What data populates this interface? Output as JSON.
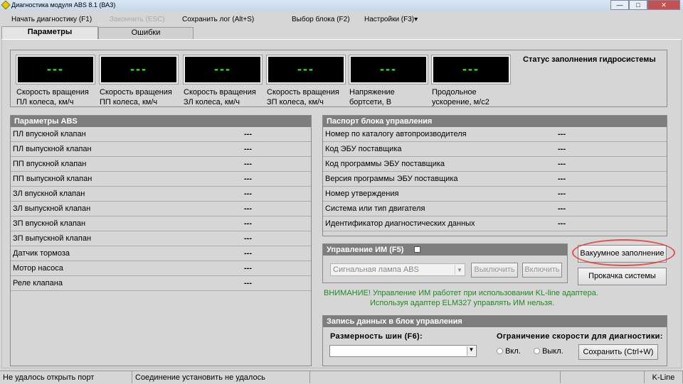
{
  "window": {
    "title": "Диагностика модуля ABS 8.1 (ВАЗ)",
    "minimize": "—",
    "maximize": "□",
    "close": "✕"
  },
  "menu": {
    "start": "Начать диагностику (F1)",
    "stop": "Закончить (ESC)",
    "save_log": "Сохранить лог (Alt+S)",
    "select_block": "Выбор блока (F2)",
    "settings": "Настройки (F3)▾"
  },
  "tabs": [
    {
      "label": "Параметры",
      "active": true
    },
    {
      "label": "Ошибки",
      "active": false
    }
  ],
  "gauges": [
    {
      "value": "---",
      "l1": "Скорость вращения",
      "l2": "ПЛ колеса, км/ч"
    },
    {
      "value": "---",
      "l1": "Скорость вращения",
      "l2": "ПП колеса, км/ч"
    },
    {
      "value": "---",
      "l1": "Скорость вращения",
      "l2": "ЗЛ колеса, км/ч"
    },
    {
      "value": "---",
      "l1": "Скорость вращения",
      "l2": "ЗП колеса, км/ч"
    },
    {
      "value": "---",
      "l1": "Напряжение",
      "l2": "бортсети, В"
    },
    {
      "value": "---",
      "l1": "Продольное",
      "l2": "ускорение, м/с2"
    }
  ],
  "hydro_status": "Статус заполнения гидросистемы",
  "abs_params": {
    "title": "Параметры ABS",
    "rows": [
      {
        "name": "ПЛ впускной клапан",
        "value": "---"
      },
      {
        "name": "ПЛ выпускной клапан",
        "value": "---"
      },
      {
        "name": "ПП впускной клапан",
        "value": "---"
      },
      {
        "name": "ПП выпускной клапан",
        "value": "---"
      },
      {
        "name": "ЗЛ впускной клапан",
        "value": "---"
      },
      {
        "name": "ЗЛ выпускной клапан",
        "value": "---"
      },
      {
        "name": "ЗП впускной клапан",
        "value": "---"
      },
      {
        "name": "ЗП выпускной клапан",
        "value": "---"
      },
      {
        "name": "Датчик тормоза",
        "value": "---"
      },
      {
        "name": "Мотор насоса",
        "value": "---"
      },
      {
        "name": "Реле клапана",
        "value": "---"
      }
    ]
  },
  "passport": {
    "title": "Паспорт блока управления",
    "rows": [
      {
        "name": "Номер по каталогу автопроизводителя",
        "value": "---"
      },
      {
        "name": "Код ЭБУ поставщика",
        "value": "---"
      },
      {
        "name": "Код программы ЭБУ поставщика",
        "value": "---"
      },
      {
        "name": "Версия программы ЭБУ поставщика",
        "value": "---"
      },
      {
        "name": "Номер утверждения",
        "value": "---"
      },
      {
        "name": "Система или тип двигателя",
        "value": "---"
      },
      {
        "name": "Идентификатор диагностических данных",
        "value": "---"
      }
    ]
  },
  "im_control": {
    "title": "Управление ИМ (F5)",
    "select": "Сигнальная лампа ABS",
    "off": "Выключить",
    "on": "Включить"
  },
  "buttons": {
    "vacuum": "Вакуумное заполнение",
    "bleed": "Прокачка системы"
  },
  "warning": {
    "line1": "ВНИМАНИЕ! Управление ИМ работет при использовании KL-line адаптера.",
    "line2": "Используя адаптер ELM327 управлять ИМ нельзя."
  },
  "write": {
    "title": "Запись данных в блок управления",
    "tire_label": "Размерность шин (F6):",
    "tire_value": "",
    "speed_label": "Ограничение скорости для диагностики:",
    "on": "Вкл.",
    "off": "Выкл.",
    "save": "Сохранить  (Ctrl+W)"
  },
  "statusbar": {
    "s1": "Не удалось открыть порт",
    "s2": "Соединение установить не удалось",
    "s3": "",
    "s4": "K-Line"
  },
  "colors": {
    "gauge_text": "#2ee82e",
    "header": "#7e7e7e",
    "warning": "#1f8a1f",
    "highlight": "#e03030"
  }
}
